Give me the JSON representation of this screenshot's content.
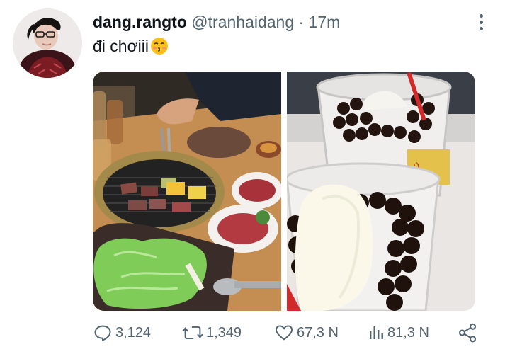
{
  "tweet": {
    "display_name": "dang.rangto",
    "handle": "@tranhaidang",
    "separator": "·",
    "time": "17m",
    "text": "đi chơiii",
    "emoji": "kissing-face-emoji",
    "avatar": "user-avatar-photo",
    "media": [
      {
        "name": "grill-bbq-photo"
      },
      {
        "name": "ice-cream-boba-photo"
      }
    ]
  },
  "actions": {
    "replies": "3,124",
    "retweets": "1,349",
    "likes": "67,3 N",
    "views": "81,3 N"
  },
  "colors": {
    "text": "#0f1419",
    "secondary": "#536471",
    "background": "#ffffff"
  }
}
